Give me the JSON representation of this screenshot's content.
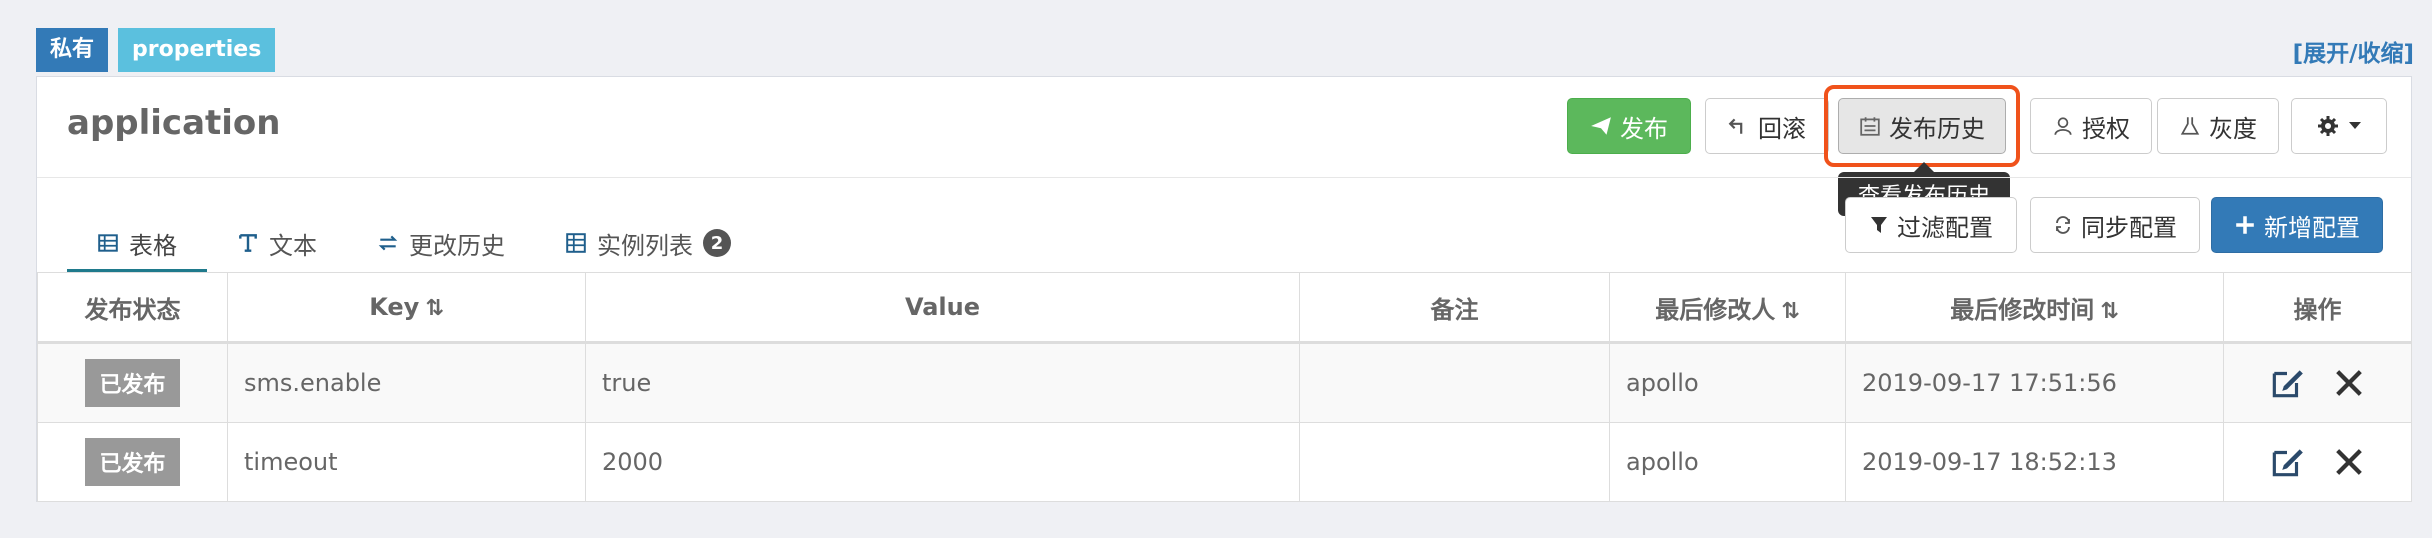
{
  "namespace": {
    "tag_private": "私有",
    "tag_format": "properties",
    "toggle": "[展开/收缩]",
    "title": "application"
  },
  "toolbar": {
    "publish": "发布",
    "rollback": "回滚",
    "history": "发布历史",
    "authorize": "授权",
    "gray": "灰度",
    "tooltip": "查看发布历史",
    "filter": "过滤配置",
    "sync": "同步配置",
    "add": "新增配置"
  },
  "tabs": [
    {
      "label": "表格",
      "icon": "table-icon"
    },
    {
      "label": "文本",
      "icon": "text-icon"
    },
    {
      "label": "更改历史",
      "icon": "exchange-icon"
    },
    {
      "label": "实例列表",
      "icon": "instance-icon",
      "badge": "2"
    }
  ],
  "table": {
    "headers": [
      "发布状态",
      "Key",
      "Value",
      "备注",
      "最后修改人",
      "最后修改时间",
      "操作"
    ],
    "rows": [
      {
        "status": "已发布",
        "key": "sms.enable",
        "value": "true",
        "comment": "",
        "modifier": "apollo",
        "time": "2019-09-17 17:51:56"
      },
      {
        "status": "已发布",
        "key": "timeout",
        "value": "2000",
        "comment": "",
        "modifier": "apollo",
        "time": "2019-09-17 18:52:13"
      }
    ]
  },
  "colors": {
    "primary": "#337ab7",
    "success": "#5cb85c",
    "highlight": "#f0521b",
    "tab_active": "#1f7a8c"
  }
}
